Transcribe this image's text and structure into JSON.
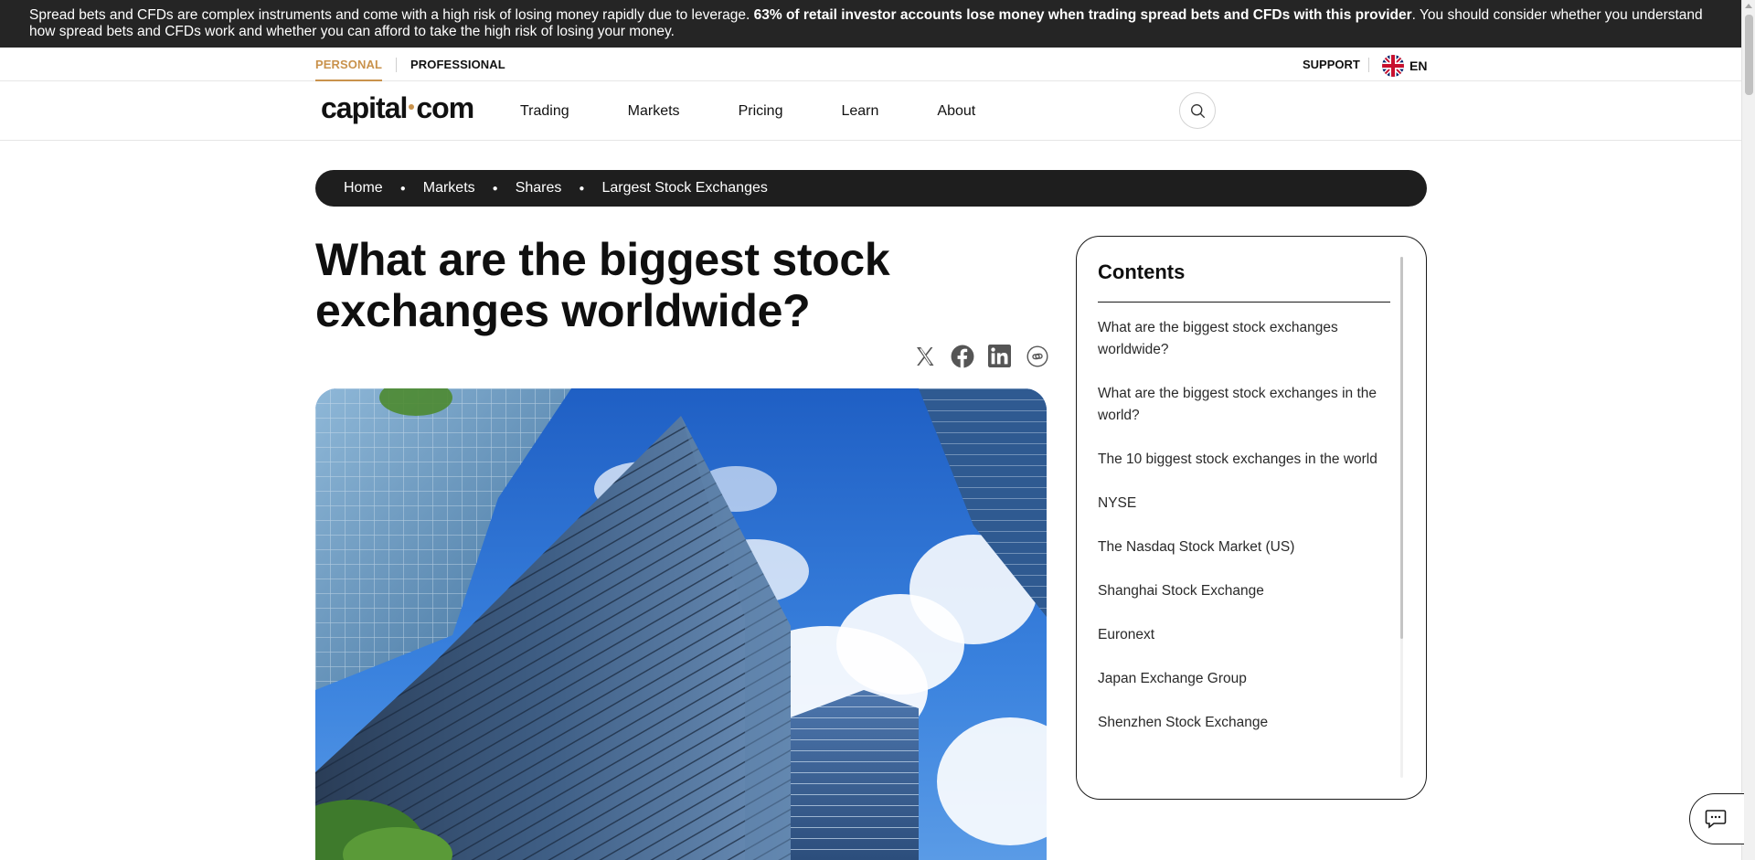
{
  "risk_banner": {
    "text_start": "Spread bets and CFDs are complex instruments and come with a high risk of losing money rapidly due to leverage. ",
    "text_bold": "63% of retail investor accounts lose money when trading spread bets and CFDs with this provider",
    "text_end": ". You should consider whether you understand how spread bets and CFDs work and whether you can afford to take the high risk of losing your money."
  },
  "topbar": {
    "personal": "PERSONAL",
    "professional": "PROFESSIONAL",
    "support": "SUPPORT",
    "language": "EN",
    "active_color": "#c9924c"
  },
  "nav": {
    "logo_left": "capital",
    "logo_right": "com",
    "items": [
      "Trading",
      "Markets",
      "Pricing",
      "Learn",
      "About"
    ]
  },
  "breadcrumb": [
    "Home",
    "Markets",
    "Shares",
    "Largest Stock Exchanges"
  ],
  "article": {
    "title": "What are the biggest stock exchanges worldwide?"
  },
  "share_icons": [
    "x-icon",
    "facebook-icon",
    "linkedin-icon",
    "copy-link-icon"
  ],
  "contents": {
    "title": "Contents",
    "items": [
      "What are the biggest stock exchanges worldwide?",
      "What are the biggest stock exchanges in the world?",
      "The 10 biggest stock exchanges in the world",
      "NYSE",
      "The Nasdaq Stock Market (US)",
      "Shanghai Stock Exchange",
      "Euronext",
      "Japan Exchange Group",
      "Shenzhen Stock Exchange"
    ]
  },
  "colors": {
    "banner_bg": "#252525",
    "breadcrumb_bg": "#1e1e1e",
    "accent": "#c9924c"
  }
}
